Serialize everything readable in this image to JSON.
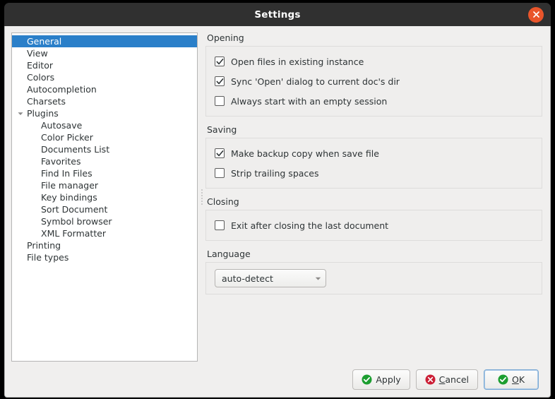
{
  "window": {
    "title": "Settings",
    "close_icon": "close-icon",
    "accent_selection": "#2a7fc9",
    "titlebar_bg": "#303030",
    "close_btn_color": "#e9552b"
  },
  "sidebar": {
    "items": [
      {
        "label": "General",
        "level": 0,
        "selected": true,
        "expander": "none"
      },
      {
        "label": "View",
        "level": 0,
        "selected": false,
        "expander": "none"
      },
      {
        "label": "Editor",
        "level": 0,
        "selected": false,
        "expander": "none"
      },
      {
        "label": "Colors",
        "level": 0,
        "selected": false,
        "expander": "none"
      },
      {
        "label": "Autocompletion",
        "level": 0,
        "selected": false,
        "expander": "none"
      },
      {
        "label": "Charsets",
        "level": 0,
        "selected": false,
        "expander": "none"
      },
      {
        "label": "Plugins",
        "level": 0,
        "selected": false,
        "expander": "expanded"
      },
      {
        "label": "Autosave",
        "level": 1,
        "selected": false,
        "expander": "none"
      },
      {
        "label": "Color Picker",
        "level": 1,
        "selected": false,
        "expander": "none"
      },
      {
        "label": "Documents List",
        "level": 1,
        "selected": false,
        "expander": "none"
      },
      {
        "label": "Favorites",
        "level": 1,
        "selected": false,
        "expander": "none"
      },
      {
        "label": "Find In Files",
        "level": 1,
        "selected": false,
        "expander": "none"
      },
      {
        "label": "File manager",
        "level": 1,
        "selected": false,
        "expander": "none"
      },
      {
        "label": "Key bindings",
        "level": 1,
        "selected": false,
        "expander": "none"
      },
      {
        "label": "Sort Document",
        "level": 1,
        "selected": false,
        "expander": "none"
      },
      {
        "label": "Symbol browser",
        "level": 1,
        "selected": false,
        "expander": "none"
      },
      {
        "label": "XML Formatter",
        "level": 1,
        "selected": false,
        "expander": "none"
      },
      {
        "label": "Printing",
        "level": 0,
        "selected": false,
        "expander": "none"
      },
      {
        "label": "File types",
        "level": 0,
        "selected": false,
        "expander": "none"
      }
    ]
  },
  "main": {
    "groups": [
      {
        "title": "Opening",
        "checkboxes": [
          {
            "label": "Open files in existing instance",
            "checked": true
          },
          {
            "label": "Sync 'Open' dialog to current doc's dir",
            "checked": true
          },
          {
            "label": "Always start with an empty session",
            "checked": false
          }
        ]
      },
      {
        "title": "Saving",
        "checkboxes": [
          {
            "label": "Make backup copy when save file",
            "checked": true
          },
          {
            "label": "Strip trailing spaces",
            "checked": false
          }
        ]
      },
      {
        "title": "Closing",
        "checkboxes": [
          {
            "label": "Exit after closing the last document",
            "checked": false
          }
        ]
      }
    ],
    "language": {
      "title": "Language",
      "selected": "auto-detect",
      "arrow_icon": "chevron-down-icon"
    }
  },
  "footer": {
    "buttons": [
      {
        "label": "Apply",
        "icon": "check-circle-icon",
        "accel": "",
        "focused": false
      },
      {
        "label": "Cancel",
        "icon": "cancel-circle-icon",
        "accel": "C",
        "focused": false
      },
      {
        "label": "OK",
        "icon": "check-circle-icon",
        "accel": "O",
        "focused": true
      }
    ]
  }
}
